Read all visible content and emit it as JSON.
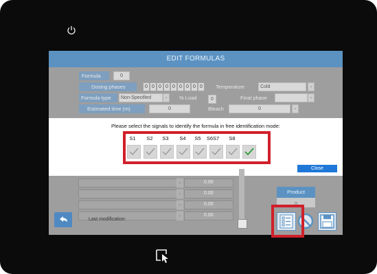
{
  "header": {
    "title": "EDIT FORMULAS"
  },
  "form": {
    "formula_label": "Formula",
    "formula_value": "0",
    "dosing_label": "Dosing phases",
    "dosing_cells": [
      "0",
      "0",
      "0",
      "0",
      "0",
      "0",
      "0",
      "0",
      "0"
    ],
    "temperature_label": "Temperature",
    "temperature_value": "Cold",
    "formula_type_label": "Formula type",
    "formula_type_value": "Non-Specified",
    "load_label": "% Load",
    "load_value": "0",
    "final_phase_label": "Final phase",
    "estimated_time_label": "Estimated time (m)",
    "estimated_time_value": "0",
    "bleach_label": "Bleach",
    "bleach_value": "0"
  },
  "dialog": {
    "prompt": "Please select the signals to identify the formula in free identification mode:",
    "signals": [
      "S1",
      "S2",
      "S3",
      "S4",
      "S5",
      "S6S7",
      "S8"
    ],
    "checked": [
      false,
      false,
      false,
      false,
      false,
      false,
      false,
      true
    ],
    "close_label": "Close"
  },
  "table": {
    "values": [
      "0.00",
      "0.00",
      "0.00",
      "0.00"
    ]
  },
  "footer": {
    "last_modification_label": "Last modification:",
    "product_label": "Product",
    "product_value": "0"
  },
  "colors": {
    "accent": "#5b92c2",
    "highlight": "#d0202a",
    "close": "#1f78d8",
    "check_active": "#2e9e3a"
  },
  "icons": [
    "power-icon",
    "back-arrow-icon",
    "list-icon",
    "ban-icon",
    "save-icon",
    "touch-icon"
  ]
}
